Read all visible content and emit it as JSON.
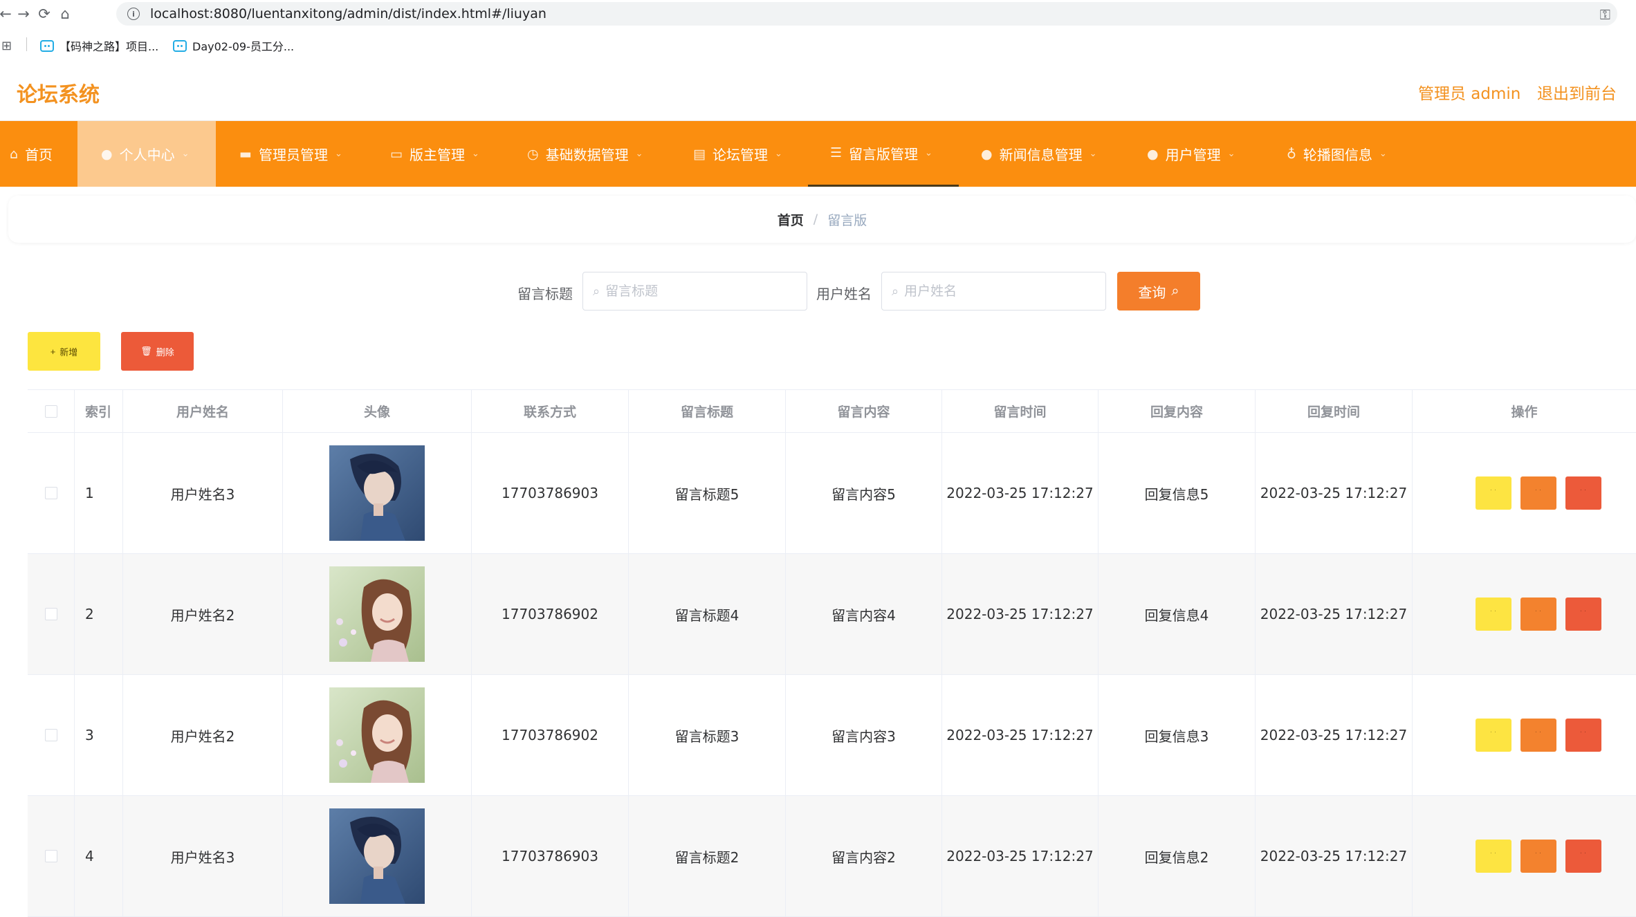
{
  "browser": {
    "url": "localhost:8080/luentanxitong/admin/dist/index.html#/liuyan",
    "bookmarks": [
      {
        "label": "【码神之路】项目..."
      },
      {
        "label": "Day02-09-员工分..."
      }
    ]
  },
  "header": {
    "logo": "论坛系统",
    "admin_label": "管理员 admin",
    "exit_label": "退出到前台"
  },
  "menu": {
    "items": [
      {
        "label": "首页",
        "icon": "home-icon"
      },
      {
        "label": "个人中心",
        "icon": "user-icon"
      },
      {
        "label": "管理员管理",
        "icon": "briefcase-icon"
      },
      {
        "label": "版主管理",
        "icon": "monitor-icon"
      },
      {
        "label": "基础数据管理",
        "icon": "clock-icon"
      },
      {
        "label": "论坛管理",
        "icon": "book-icon"
      },
      {
        "label": "留言版管理",
        "icon": "list-icon"
      },
      {
        "label": "新闻信息管理",
        "icon": "user-icon"
      },
      {
        "label": "用户管理",
        "icon": "user-icon"
      },
      {
        "label": "轮播图信息",
        "icon": "bulb-icon"
      }
    ]
  },
  "breadcrumb": {
    "home": "首页",
    "separator": "/",
    "current": "留言版"
  },
  "search": {
    "title_label": "留言标题",
    "title_placeholder": "留言标题",
    "name_label": "用户姓名",
    "name_placeholder": "用户姓名",
    "query_label": "查询"
  },
  "actions": {
    "add_label": "新增",
    "delete_label": "删除"
  },
  "table": {
    "columns": [
      "索引",
      "用户姓名",
      "头像",
      "联系方式",
      "留言标题",
      "留言内容",
      "留言时间",
      "回复内容",
      "回复时间",
      "操作"
    ],
    "rows": [
      {
        "index": "1",
        "name": "用户姓名3",
        "avatar": "male-anime-avatar",
        "phone": "17703786903",
        "title": "留言标题5",
        "content": "留言内容5",
        "time": "2022-03-25 17:12:27",
        "reply": "回复信息5",
        "reply_time": "2022-03-25 17:12:27"
      },
      {
        "index": "2",
        "name": "用户姓名2",
        "avatar": "female-photo-avatar",
        "phone": "17703786902",
        "title": "留言标题4",
        "content": "留言内容4",
        "time": "2022-03-25 17:12:27",
        "reply": "回复信息4",
        "reply_time": "2022-03-25 17:12:27"
      },
      {
        "index": "3",
        "name": "用户姓名2",
        "avatar": "female-photo-avatar",
        "phone": "17703786902",
        "title": "留言标题3",
        "content": "留言内容3",
        "time": "2022-03-25 17:12:27",
        "reply": "回复信息3",
        "reply_time": "2022-03-25 17:12:27"
      },
      {
        "index": "4",
        "name": "用户姓名3",
        "avatar": "male-anime-avatar",
        "phone": "17703786903",
        "title": "留言标题2",
        "content": "留言内容2",
        "time": "2022-03-25 17:12:27",
        "reply": "回复信息2",
        "reply_time": "2022-03-25 17:12:27"
      }
    ]
  },
  "colors": {
    "brand": "#f39220",
    "menu_bg": "#fb8e0f",
    "menu_active_bg": "#fcc98e",
    "detail_button": "#fde442",
    "edit_button": "#f3822e",
    "delete_button": "#ec5a3a"
  }
}
